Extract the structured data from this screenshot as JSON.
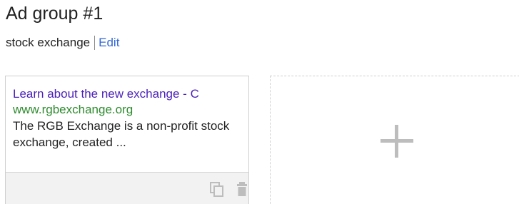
{
  "ad_group": {
    "title": "Ad group #1",
    "keyword": "stock exchange",
    "edit_label": "Edit"
  },
  "ad": {
    "headline": "Learn about the new exchange - C",
    "display_url": "www.rgbexchange.org",
    "description": "The RGB Exchange is a non-profit stock exchange, created ..."
  },
  "icons": {
    "copy": "copy-icon",
    "delete": "trash-icon",
    "add": "plus-icon"
  },
  "colors": {
    "headline": "#4a1fb8",
    "url": "#2e8b2e",
    "link": "#3367d6",
    "icon": "#bdbdbd"
  }
}
